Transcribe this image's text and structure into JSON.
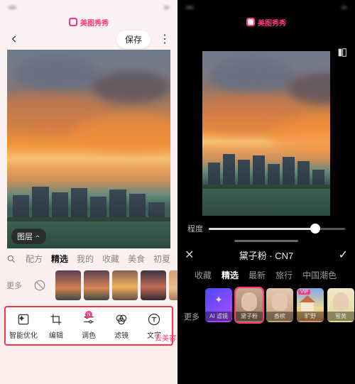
{
  "brand": "美图秀秀",
  "left": {
    "save": "保存",
    "layer_button": "图层",
    "tabs": {
      "fangfa": "配方",
      "jingxuan": "精选",
      "wode": "我的",
      "shoucang": "收藏",
      "meishi": "美食",
      "chuxia": "初夏"
    },
    "more": "更多",
    "tools": {
      "smart": "智能优化",
      "edit": "编辑",
      "color": "调色",
      "filter": "滤镜",
      "text": "文字"
    },
    "right_label": "去美容",
    "badge_n": "N"
  },
  "right": {
    "intensity_label": "程度",
    "filter_name": "黛子粉 · CN7",
    "tabs": {
      "shoucang": "收藏",
      "jingxuan": "精选",
      "zuixin": "最新",
      "lvxing": "旅行",
      "chaose": "中国潮色"
    },
    "more": "更多",
    "ai_label": "AI 滤镜",
    "thumbs": {
      "t1": "黛子粉",
      "t2": "香槟",
      "t3": "旷野",
      "t4": "蜜黄",
      "vip": "VIP"
    }
  }
}
